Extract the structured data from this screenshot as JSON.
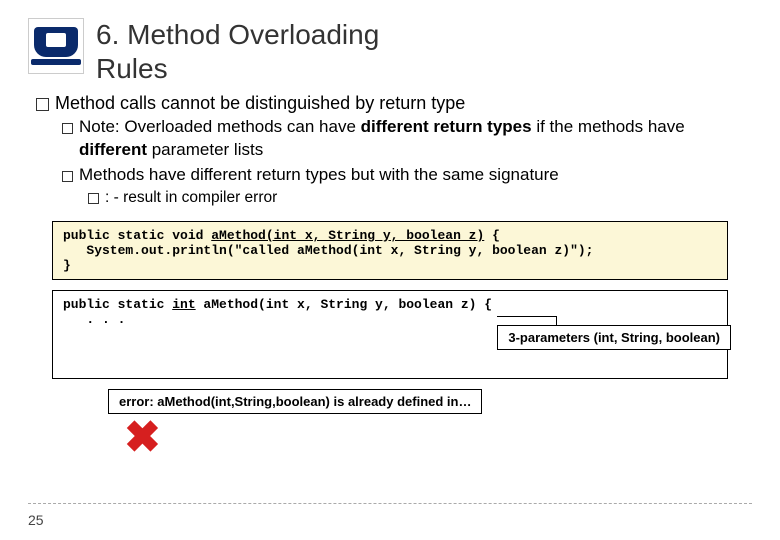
{
  "header": {
    "title_line1": "6. Method Overloading",
    "title_line2": "Rules"
  },
  "bullets": {
    "b1": "Method calls cannot be distinguished by return type",
    "b2a_prefix": "Note:",
    "b2a_mid1": " Overloaded methods can have ",
    "b2a_bold1": "different return types",
    "b2a_mid2": " if the methods have ",
    "b2a_bold2": "different",
    "b2a_mid3": " parameter lists",
    "b2b": "Methods have different return types but with the same signature",
    "b3_prefix": ": -",
    "b3_text": " result in compiler error"
  },
  "code1": {
    "l1a": "public static void ",
    "l1b": "aMethod(int x, String y, boolean z)",
    "l1c": " {",
    "l2": "   System.out.println(\"called aMethod(int x, String y, boolean z)\");",
    "l3": "}"
  },
  "code2": {
    "l1a": "public static ",
    "l1b": "int",
    "l1c": " aMethod(int x, String y, boolean z) {",
    "l2": "   . . .",
    "callout": "3-parameters (int, String, boolean)"
  },
  "error_text": "error: aMethod(int,String,boolean) is already defined in…",
  "page_number": "25"
}
